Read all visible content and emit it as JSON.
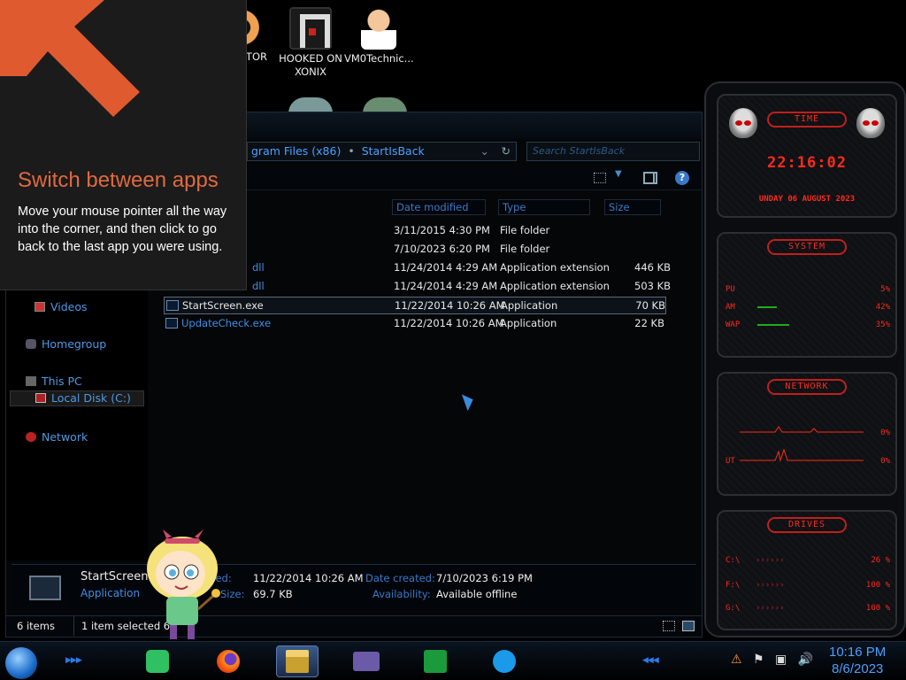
{
  "desktop": {
    "icons": [
      {
        "label": "TOR",
        "icon": "monitor-app-icon"
      },
      {
        "label": "HOOKED ON XONIX",
        "icon": "xonix-game-icon"
      },
      {
        "label": "VM0Technic...",
        "icon": "technician-icon"
      }
    ]
  },
  "tip": {
    "title": "Switch between apps",
    "body": "Move your mouse pointer all the way into the corner, and then click to go back to the last app you were using."
  },
  "explorer": {
    "address": {
      "part1": "gram Files (x86)",
      "part2": "StartIsBack"
    },
    "search_placeholder": "Search StartIsBack",
    "help": "?",
    "nav": {
      "videos": "Videos",
      "homegroup": "Homegroup",
      "this_pc": "This PC",
      "local_disk": "Local Disk (C:)",
      "network": "Network"
    },
    "columns": {
      "date": "Date modified",
      "type": "Type",
      "size": "Size"
    },
    "files": [
      {
        "name": "",
        "date": "3/11/2015 4:30 PM",
        "type": "File folder",
        "size": ""
      },
      {
        "name": "",
        "date": "7/10/2023 6:20 PM",
        "type": "File folder",
        "size": ""
      },
      {
        "name": "dll",
        "date": "11/24/2014 4:29 AM",
        "type": "Application extension",
        "size": "446 KB"
      },
      {
        "name": "dll",
        "date": "11/24/2014 4:29 AM",
        "type": "Application extension",
        "size": "503 KB"
      },
      {
        "name": "StartScreen.exe",
        "date": "11/22/2014 10:26 AM",
        "type": "Application",
        "size": "70 KB"
      },
      {
        "name": "UpdateCheck.exe",
        "date": "11/22/2014 10:26 AM",
        "type": "Application",
        "size": "22 KB"
      }
    ],
    "details": {
      "name": "StartScreen.e",
      "kind": "Application",
      "modified_label": "ified:",
      "modified_value": "11/22/2014 10:26 AM",
      "created_label": "Date created:",
      "created_value": "7/10/2023 6:19 PM",
      "size_label": "Size:",
      "size_value": "69.7 KB",
      "availability_label": "Availability:",
      "availability_value": "Available offline"
    },
    "status": {
      "count": "6 items",
      "selected": "1 item selected  6"
    }
  },
  "gadget": {
    "time_title": "TIME",
    "time": "22:16:02",
    "date": "UNDAY 06 AUGUST 2023",
    "system_title": "SYSTEM",
    "system": [
      {
        "label": "PU",
        "value": "5%"
      },
      {
        "label": "AM",
        "value": "42%"
      },
      {
        "label": "WAP",
        "value": "35%"
      }
    ],
    "network_title": "NETWORK",
    "network": [
      {
        "label": "",
        "value": "0%"
      },
      {
        "label": "UT",
        "value": "0%"
      }
    ],
    "drives_title": "DRIVES",
    "drives": [
      {
        "label": "C:\\",
        "value": "26 %"
      },
      {
        "label": "F:\\",
        "value": "100 %"
      },
      {
        "label": "G:\\",
        "value": "100 %"
      }
    ],
    "color": "#ff2a1a"
  },
  "taskbar": {
    "apps": [
      "notes-icon",
      "firefox-icon",
      "file-explorer-icon",
      "app-icon",
      "stocks-icon",
      "skype-icon"
    ],
    "clock_time": "10:16 PM",
    "clock_date": "8/6/2023"
  }
}
